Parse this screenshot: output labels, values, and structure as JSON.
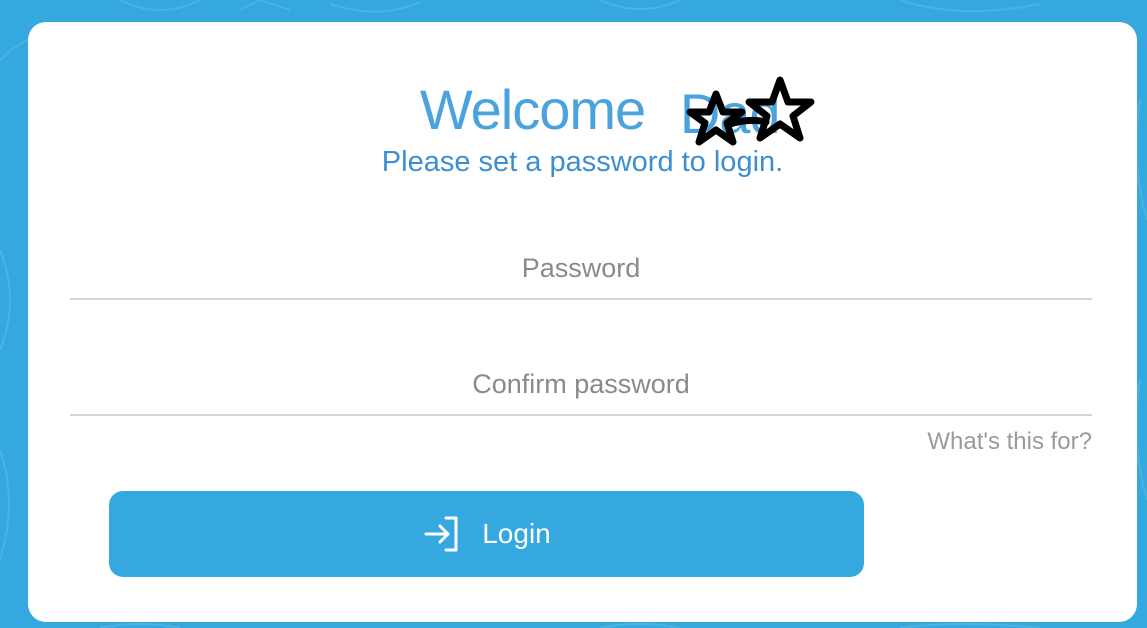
{
  "welcome": {
    "prefix": "Welcome",
    "redacted_name": "Dad"
  },
  "subtitle": "Please set a password to login.",
  "fields": {
    "password": {
      "placeholder": "Password",
      "value": ""
    },
    "confirm": {
      "placeholder": "Confirm password",
      "value": ""
    }
  },
  "help_link": "What's this for?",
  "login_button": {
    "label": "Login",
    "icon": "login-arrow-icon"
  },
  "colors": {
    "background": "#36a8e0",
    "accent": "#4aa3de",
    "button": "#36a8e0"
  }
}
